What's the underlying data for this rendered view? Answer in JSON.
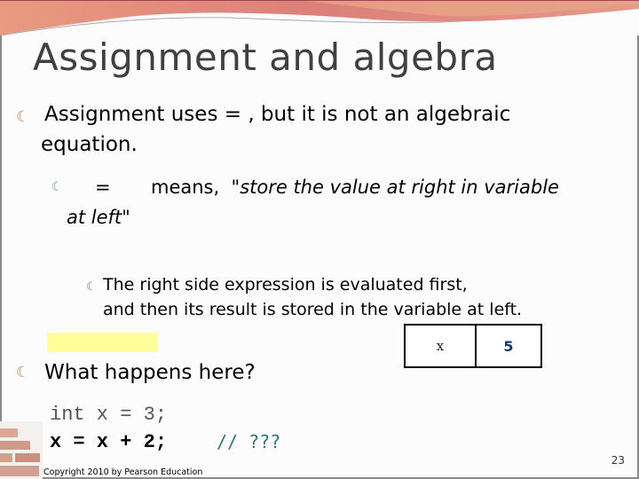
{
  "slide": {
    "title": "Assignment and algebra",
    "bullets": {
      "main1_line1": "Assignment uses = , but it is not an algebraic",
      "main1_line2": "equation.",
      "sub1_eq": "=",
      "sub1_means": "means,",
      "sub1_quote_line1": "\"store the value at right in variable",
      "sub1_quote_line2": "at left\"",
      "subsub1_line1": "The right side expression is evaluated first,",
      "subsub1_line2": "and then its result is stored in the variable at left.",
      "main2": "What happens here?"
    },
    "variable_box": {
      "name": "x",
      "value": "5"
    },
    "code": {
      "line1": "int x = 3;",
      "line2": "x = x + 2;",
      "comment": "// ???"
    },
    "footer": {
      "copyright": "Copyright 2010 by Pearson Education",
      "page_number": "23"
    },
    "bullet_icon": "scroll-bullet-icon",
    "colors": {
      "header_accent": "#e8836a",
      "highlight": "#ffff99",
      "comment": "#2a7a7a",
      "value": "#1a3a6a"
    }
  }
}
